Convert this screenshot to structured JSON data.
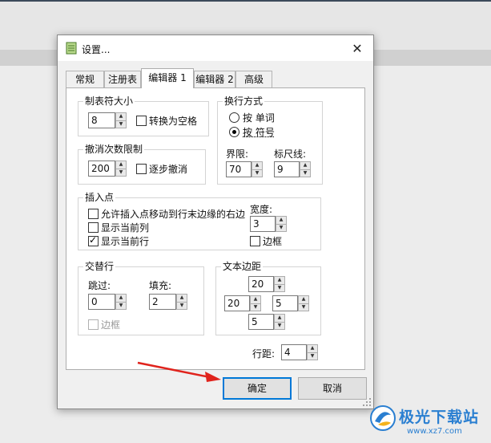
{
  "dialog": {
    "title": "设置...",
    "close_glyph": "✕"
  },
  "tabs": [
    {
      "label": "常规"
    },
    {
      "label": "注册表"
    },
    {
      "label": "编辑器 1"
    },
    {
      "label": "编辑器 2"
    },
    {
      "label": "高级"
    }
  ],
  "tab_size": {
    "legend": "制表符大小",
    "value": "8",
    "to_space_label": "转换为空格",
    "to_space_checked": false
  },
  "undo": {
    "legend": "撤消次数限制",
    "value": "200",
    "stepwise_label": "逐步撤消",
    "stepwise_checked": false
  },
  "wrap": {
    "legend": "换行方式",
    "by_word_label": "按 单词",
    "by_symbol_label": "按 符号",
    "selected": "by_symbol",
    "limit_label": "界限:",
    "limit_value": "70",
    "ruler_label": "标尺线:",
    "ruler_value": "9"
  },
  "caret": {
    "legend": "插入点",
    "allow_past_eol_label": "允许插入点移动到行末边缘的右边",
    "allow_past_eol_checked": false,
    "show_column_label": "显示当前列",
    "show_column_checked": false,
    "show_line_label": "显示当前行",
    "show_line_checked": true,
    "width_label": "宽度:",
    "width_value": "3",
    "border_label": "边框",
    "border_checked": false
  },
  "alternate": {
    "legend": "交替行",
    "skip_label": "跳过:",
    "skip_value": "0",
    "fill_label": "填充:",
    "fill_value": "2",
    "border_label": "边框",
    "border_checked": false
  },
  "margins": {
    "legend": "文本边距",
    "top": "20",
    "left": "20",
    "right": "5",
    "bottom": "5"
  },
  "line_spacing": {
    "label": "行距:",
    "value": "4"
  },
  "buttons": {
    "ok": "确定",
    "cancel": "取消"
  },
  "watermark": {
    "name": "极光下载站",
    "url": "www.xz7.com"
  },
  "colors": {
    "accent": "#0078d7",
    "arrow": "#e0231c",
    "watermark": "#2a7fd1"
  }
}
